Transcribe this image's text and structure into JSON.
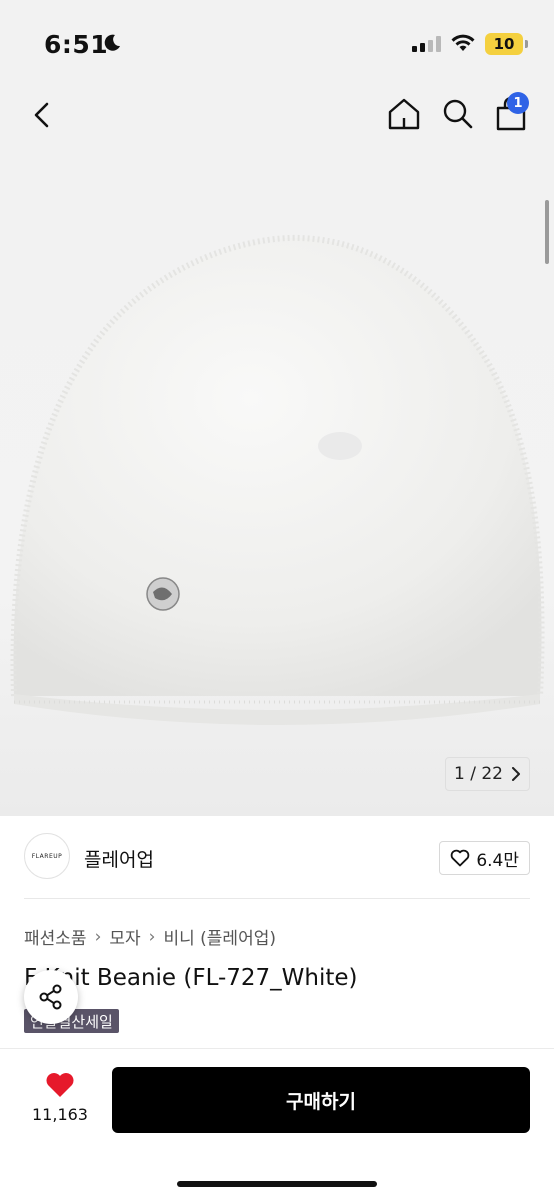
{
  "status_bar": {
    "time": "6:51",
    "battery": "10",
    "icons": [
      "moon-icon",
      "cellular-signal-icon",
      "wifi-icon",
      "battery-icon"
    ]
  },
  "top_nav": {
    "icons": [
      "back-chevron-icon",
      "home-icon",
      "search-icon",
      "cart-icon"
    ],
    "cart_badge": "1"
  },
  "gallery": {
    "counter_current": "1",
    "counter_total": "22",
    "counter_text": "1 / 22",
    "image": "white fluffy knit beanie with metal logo charm"
  },
  "brand": {
    "logo_text": "FLAREUP",
    "name": "플레어업",
    "likes": "6.4만"
  },
  "breadcrumb": [
    "패션소품",
    "모자",
    "비니 (플레어업)"
  ],
  "product": {
    "title": "Fur Knit Beanie (FL-727_White)",
    "visible_title": "F    Knit Beanie (FL-727_White)",
    "badge": "연말결산세일"
  },
  "bottom_bar": {
    "wish_count": "11,163",
    "buy_label": "구매하기"
  },
  "colors": {
    "accent_badge": "#2f63e6",
    "heart": "#e6192b",
    "buy_button": "#000000",
    "sale_badge": "#5a5468"
  }
}
